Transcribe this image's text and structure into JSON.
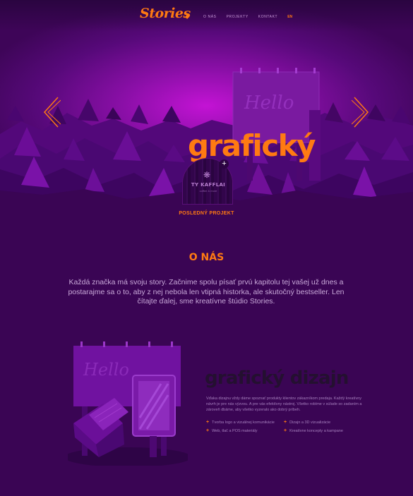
{
  "brand": {
    "logo": "Stories"
  },
  "nav": {
    "home_icon": "home-icon",
    "items": [
      "O NÁS",
      "PROJEKTY",
      "KONTAKT"
    ],
    "lang": "EN"
  },
  "hero": {
    "title": "grafický",
    "plus": "+",
    "project_label": "TY KAFFLAI",
    "project_sub": "coffee & more",
    "last_project": "POSLEDNÝ PROJEKT",
    "billboard_text": "Hello"
  },
  "about": {
    "title": "O NÁS",
    "text": "Každá značka má svoju story. Začnime spolu písať prvú kapitolu tej vašej už dnes a postarajme sa o to, aby z nej nebola len vtipná historka, ale skutočný bestseller. Len čítajte ďalej, sme kreatívne štúdio Stories."
  },
  "service": {
    "title": "grafický dizajn",
    "billboard_text": "Hello",
    "description": "Vďaka dizajnu vždy dáme spoznať produkty klientov zákazníkom predaja. Každý kreatívny návrh je pre nás výzvou. A pre vás efektívny nástroj. Všetko robíme v súlade so zadaním a zároveň dbáme, aby všetko vyzeralo ako dobrý príbeh.",
    "features": [
      "Tvorba logo a vizuálnej komunikácie",
      "Web, tlač a POS materiály",
      "Dizajn a 3D vizualizácie",
      "Kreatívne koncepty a kampane"
    ]
  },
  "colors": {
    "accent": "#ff7a12",
    "background": "#3a0554",
    "hero_glow": "#c313d4"
  }
}
